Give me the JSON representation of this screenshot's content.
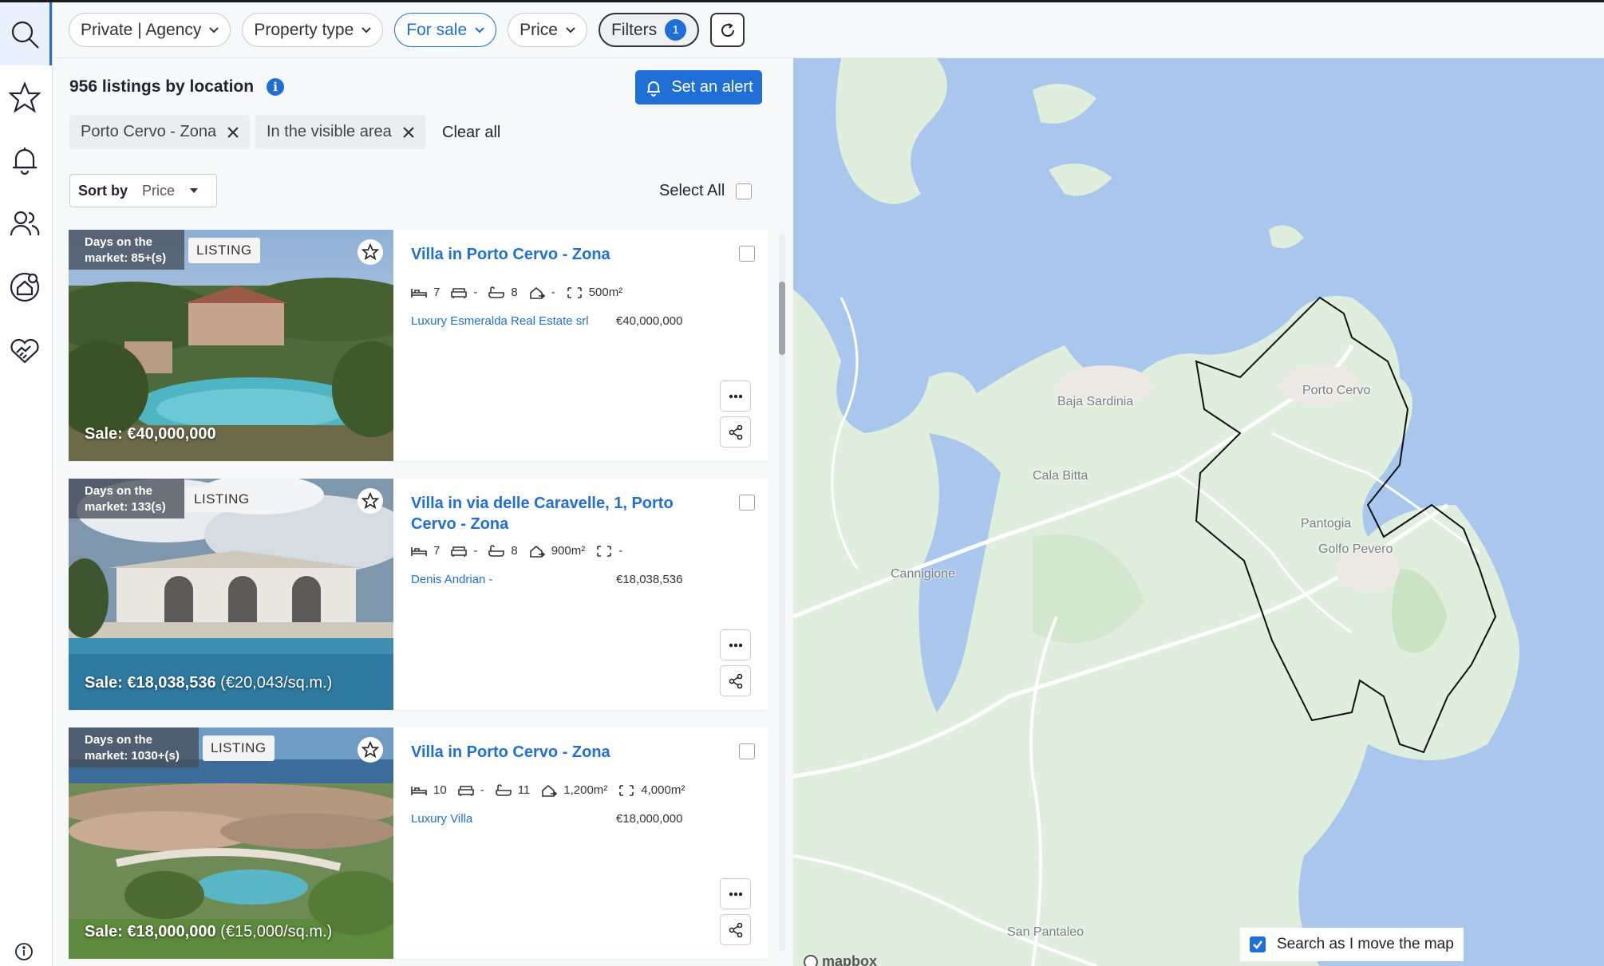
{
  "nav": {
    "items": [
      "search-icon",
      "star-icon",
      "bell-icon",
      "people-icon",
      "house-user-icon",
      "handshake-heart-icon"
    ],
    "info_icon": "info-icon"
  },
  "filters": {
    "seller": "Private | Agency",
    "property_type": "Property type",
    "transaction": "For sale",
    "price": "Price",
    "filters_label": "Filters",
    "filters_count": "1"
  },
  "listing_panel": {
    "count_text": "956 listings by location",
    "info_badge": "i",
    "alert_button": "Set an alert",
    "active_tags": [
      "Porto Cervo - Zona",
      "In the visible area"
    ],
    "clear_all": "Clear all",
    "sort_label": "Sort by",
    "sort_value": "Price",
    "select_all": "Select All"
  },
  "listings": [
    {
      "days_line1": "Days on the",
      "days_line2": "market: 85+(s)",
      "tag": "LISTING",
      "sale_price": "Sale: €40,000,000",
      "sale_per_sqm": "",
      "title": "Villa in Porto Cervo - Zona",
      "bedrooms": "7",
      "living": "-",
      "bathrooms": "8",
      "area_built": "-",
      "area_plot": "500m²",
      "agent": "Luxury Esmeralda Real Estate srl",
      "price": "€40,000,000"
    },
    {
      "days_line1": "Days on the",
      "days_line2": "market: 133(s)",
      "tag": "LISTING",
      "sale_price": "Sale: €18,038,536",
      "sale_per_sqm": "(€20,043/sq.m.)",
      "title": "Villa in via delle Caravelle, 1, Porto Cervo - Zona",
      "bedrooms": "7",
      "living": "-",
      "bathrooms": "8",
      "area_built": "900m²",
      "area_plot": "-",
      "agent": "Denis Andrian -",
      "price": "€18,038,536"
    },
    {
      "days_line1": "Days on the",
      "days_line2": "market: 1030+(s)",
      "tag": "LISTING",
      "sale_price": "Sale: €18,000,000",
      "sale_per_sqm": "(€15,000/sq.m.)",
      "title": "Villa in Porto Cervo - Zona",
      "bedrooms": "10",
      "living": "-",
      "bathrooms": "11",
      "area_built": "1,200m²",
      "area_plot": "4,000m²",
      "agent": "Luxury Villa",
      "price": "€18,000,000"
    }
  ],
  "map": {
    "labels": [
      "Baja Sardinia",
      "Cala Bitta",
      "Porto Cervo",
      "Pantogia",
      "Golfo Pevero",
      "Cannigione",
      "San Pantaleo"
    ],
    "search_as_move": "Search as I move the map",
    "attribution": "mapbox",
    "water_color": "#a9c6ec",
    "land_color": "#dfeedd"
  }
}
